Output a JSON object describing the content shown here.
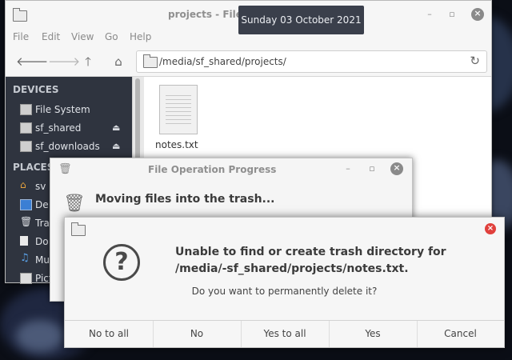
{
  "file_manager": {
    "title": "projects - File M",
    "menu": [
      "File",
      "Edit",
      "View",
      "Go",
      "Help"
    ],
    "path": "/media/sf_shared/projects/",
    "sidebar": {
      "devices_header": "DEVICES",
      "devices": [
        {
          "label": "File System",
          "icon": "drive-icon"
        },
        {
          "label": "sf_shared",
          "icon": "drive-icon",
          "eject": true
        },
        {
          "label": "sf_downloads",
          "icon": "drive-icon",
          "eject": true
        }
      ],
      "places_header": "PLACES",
      "places": [
        {
          "label": "sv",
          "icon": "home-icon"
        },
        {
          "label": "De",
          "icon": "desktop-icon"
        },
        {
          "label": "Tra",
          "icon": "trash-icon"
        },
        {
          "label": "Do",
          "icon": "documents-icon"
        },
        {
          "label": "Mu",
          "icon": "music-icon"
        },
        {
          "label": "Picture",
          "icon": "pictures-icon"
        }
      ]
    },
    "files": [
      {
        "name": "notes.txt",
        "icon": "text-file-icon"
      }
    ]
  },
  "clock_tooltip": "Sunday 03 October 2021",
  "progress_dialog": {
    "title": "File Operation Progress",
    "message": "Moving files into the trash..."
  },
  "error_dialog": {
    "primary": "Unable to find or create trash directory for /media/-sf_shared/projects/notes.txt.",
    "secondary": "Do you want to permanently delete it?",
    "buttons": {
      "no_to_all": "No to all",
      "no": "No",
      "yes_to_all": "Yes to all",
      "yes": "Yes",
      "cancel": "Cancel"
    }
  },
  "colors": {
    "sidebar_bg": "#2f343f",
    "tooltip_bg": "#3a3f4b",
    "close_red": "#e0403c"
  }
}
